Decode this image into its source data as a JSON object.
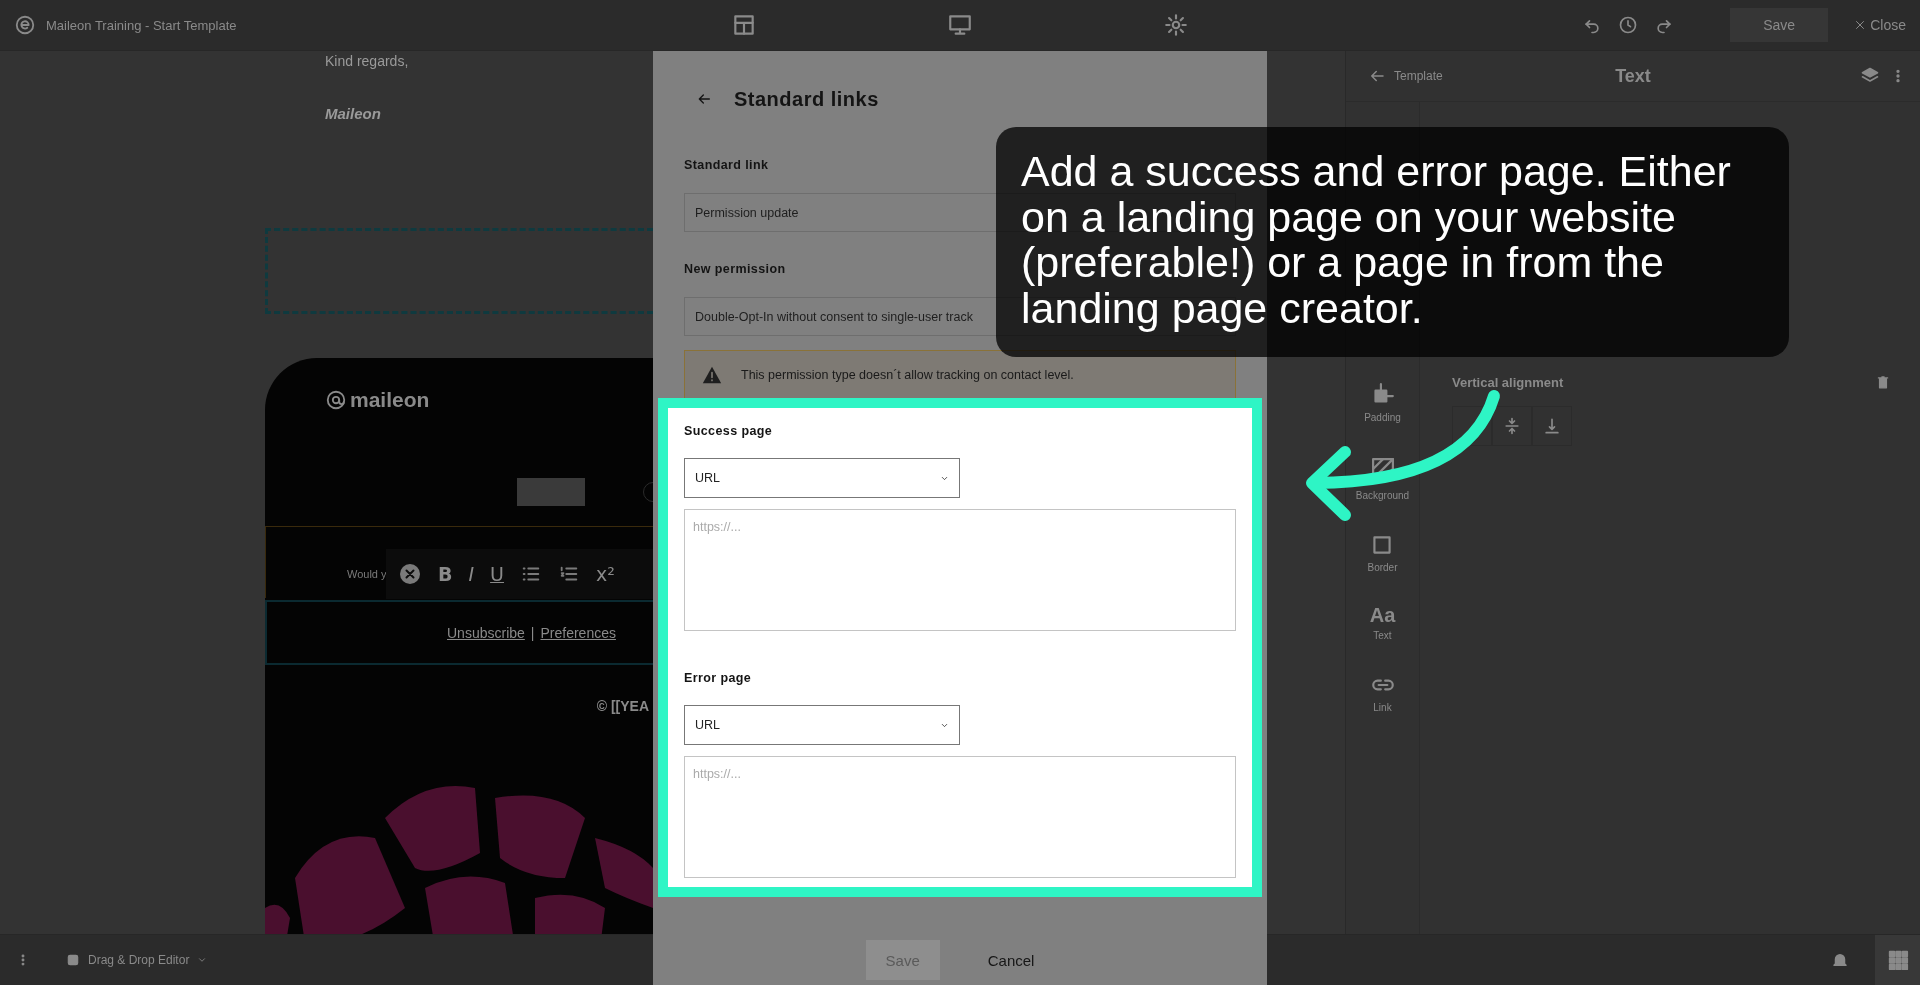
{
  "top_bar": {
    "title": "Maileon Training - Start Template",
    "save_label": "Save",
    "close_label": "Close"
  },
  "email": {
    "closing": "Kind regards,",
    "signature": "Maileon",
    "logo": "maileon",
    "greeting_partial": "Would y",
    "format_toolbar": [
      {
        "kind": "clear"
      },
      {
        "kind": "bold",
        "glyph": "B"
      },
      {
        "kind": "italic",
        "glyph": "I"
      },
      {
        "kind": "underline",
        "glyph": "U"
      },
      {
        "kind": "bullets"
      },
      {
        "kind": "numbers"
      },
      {
        "kind": "superscript",
        "glyph": "x²"
      }
    ],
    "footer_links": [
      {
        "label": "Unsubscribe"
      },
      {
        "label": "Preferences"
      }
    ],
    "link_separator": "|",
    "copyright": "© [[YEA"
  },
  "right_panel": {
    "back_label": "Template",
    "title": "Text",
    "section_label": "Vertical alignment",
    "tools": [
      {
        "kind": "padding",
        "label": "Padding"
      },
      {
        "kind": "background",
        "label": "Background"
      },
      {
        "kind": "border",
        "label": "Border"
      },
      {
        "kind": "text",
        "glyph": "Aa",
        "label": "Text"
      },
      {
        "kind": "link",
        "label": "Link"
      }
    ]
  },
  "bottom_bar": {
    "editor_label": "Drag & Drop Editor"
  },
  "modal": {
    "title": "Standard links",
    "fields": [
      {
        "label": "Standard link",
        "value": "Permission update"
      },
      {
        "label": "New permission",
        "value": "Double-Opt-In without consent to single-user track"
      }
    ],
    "warning": "This permission type doesn´t allow tracking on contact level.",
    "sections": [
      {
        "label": "Success page",
        "type": "URL",
        "placeholder": "https://..."
      },
      {
        "label": "Error page",
        "type": "URL",
        "placeholder": "https://..."
      }
    ],
    "buttons": [
      {
        "label": "Save",
        "kind": "filled",
        "disabled": true
      },
      {
        "label": "Cancel",
        "kind": "text",
        "disabled": false
      }
    ]
  },
  "callout": {
    "text": "Add a success and error page. Either on a landing page on your website (preferable!) or a page in from the landing page creator."
  }
}
